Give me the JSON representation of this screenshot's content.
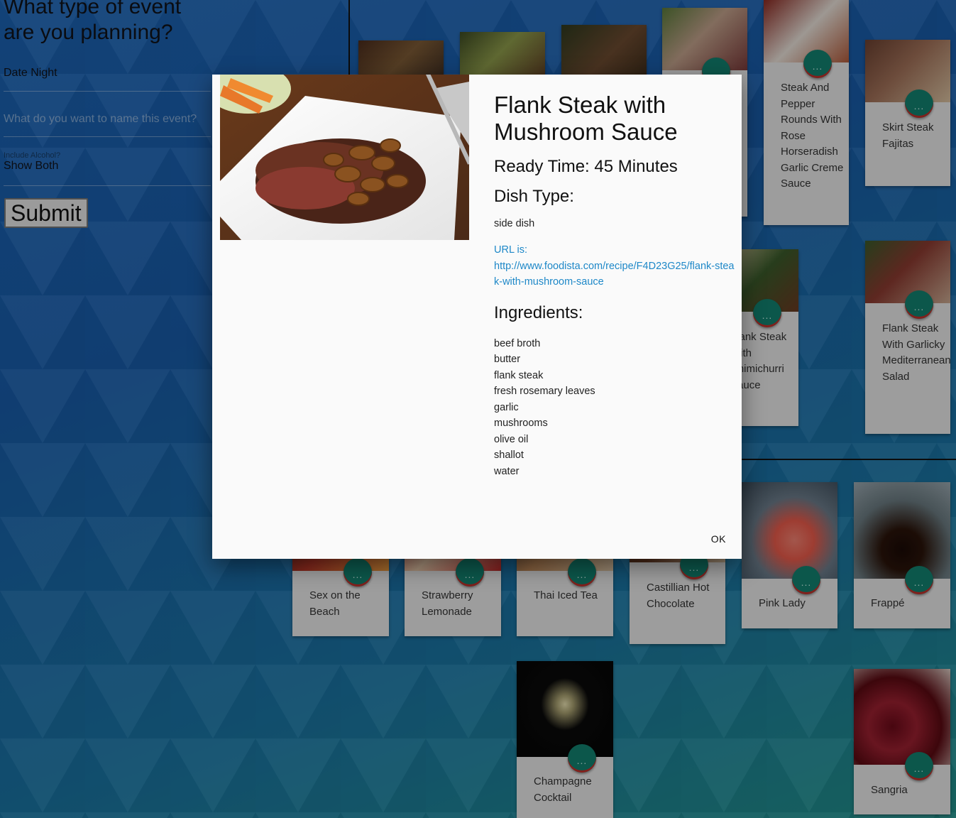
{
  "form": {
    "title": "What type of event are you planning?",
    "event_type_value": "Date Night",
    "event_name_placeholder": "What do you want to name this event?",
    "alcohol_label": "Include Alcohol?",
    "alcohol_value": "Show Both",
    "submit_label": "Submit"
  },
  "food_cards": [
    {
      "title": "",
      "image": "steak-plate"
    },
    {
      "title": "",
      "image": "steak-salad"
    },
    {
      "title": "",
      "image": "steak-herbs"
    },
    {
      "title": "",
      "image": "steak-greens"
    },
    {
      "title": "Steak And Pepper Rounds With Rose Horseradish Garlic Creme Sauce",
      "image": "steak-pepper"
    },
    {
      "title": "Skirt Steak Fajitas",
      "image": "skirt-steak"
    },
    {
      "title": "Flank Steak With Chimichurri Sauce",
      "image": "steak-rice"
    },
    {
      "title": "Flank Steak With Garlicky Mediterranean Salad",
      "image": "steak-salad-2"
    }
  ],
  "drink_cards": [
    {
      "title": "Sex on the Beach"
    },
    {
      "title": "Strawberry Lemonade"
    },
    {
      "title": "Thai Iced Tea"
    },
    {
      "title": "Castillian Hot Chocolate"
    },
    {
      "title": "Pink Lady"
    },
    {
      "title": "Frappé"
    },
    {
      "title": "Champagne Cocktail"
    },
    {
      "title": "Sangria"
    }
  ],
  "card_more_label": "...",
  "modal": {
    "title": "Flank Steak with Mushroom Sauce",
    "ready_time": "Ready Time: 45 Minutes",
    "dish_type_heading": "Dish Type:",
    "dish_type": "side dish",
    "url_label": "URL is:",
    "url": "http://www.foodista.com/recipe/F4D23G25/flank-steak-with-mushroom-sauce",
    "ingredients_heading": "Ingredients:",
    "ingredients": [
      "beef broth",
      "butter",
      "flank steak",
      "fresh rosemary leaves",
      "garlic",
      "mushrooms",
      "olive oil",
      "shallot",
      "water"
    ],
    "ok_label": "OK"
  },
  "colors": {
    "background_start": "#1c66b8",
    "background_end": "#23968f",
    "fab": "#13806f",
    "link": "#1e88c8"
  }
}
